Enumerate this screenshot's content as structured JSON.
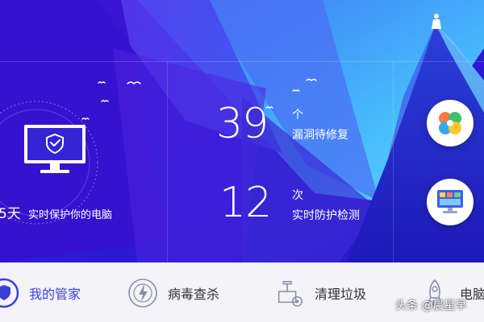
{
  "hero": {
    "days_suffix": "5天",
    "protect_label": "实时保护你的电脑"
  },
  "stats": [
    {
      "value": "39",
      "unit": "个",
      "label": "漏洞待修复"
    },
    {
      "value": "12",
      "unit": "次",
      "label": "实时防护检测"
    }
  ],
  "side_buttons": [
    {
      "icon": "clover-app-icon"
    },
    {
      "icon": "computer-app-icon"
    }
  ],
  "nav": {
    "items": [
      {
        "label": "我的管家",
        "icon": "shield-icon",
        "active": true
      },
      {
        "label": "病毒查杀",
        "icon": "lightning-scan-icon",
        "active": false
      },
      {
        "label": "清理垃圾",
        "icon": "vacuum-cleaner-icon",
        "active": false
      },
      {
        "label": "电脑",
        "icon": "rocket-icon",
        "active": false
      }
    ]
  },
  "watermark": "头条 @晨星早",
  "colors": {
    "hero_dark": "#2a0fd0",
    "hero_blue": "#3f5bf0",
    "hero_cyan": "#4fc7ff",
    "accent": "#3a3fd8",
    "nav_bg": "#f3f3f8"
  }
}
